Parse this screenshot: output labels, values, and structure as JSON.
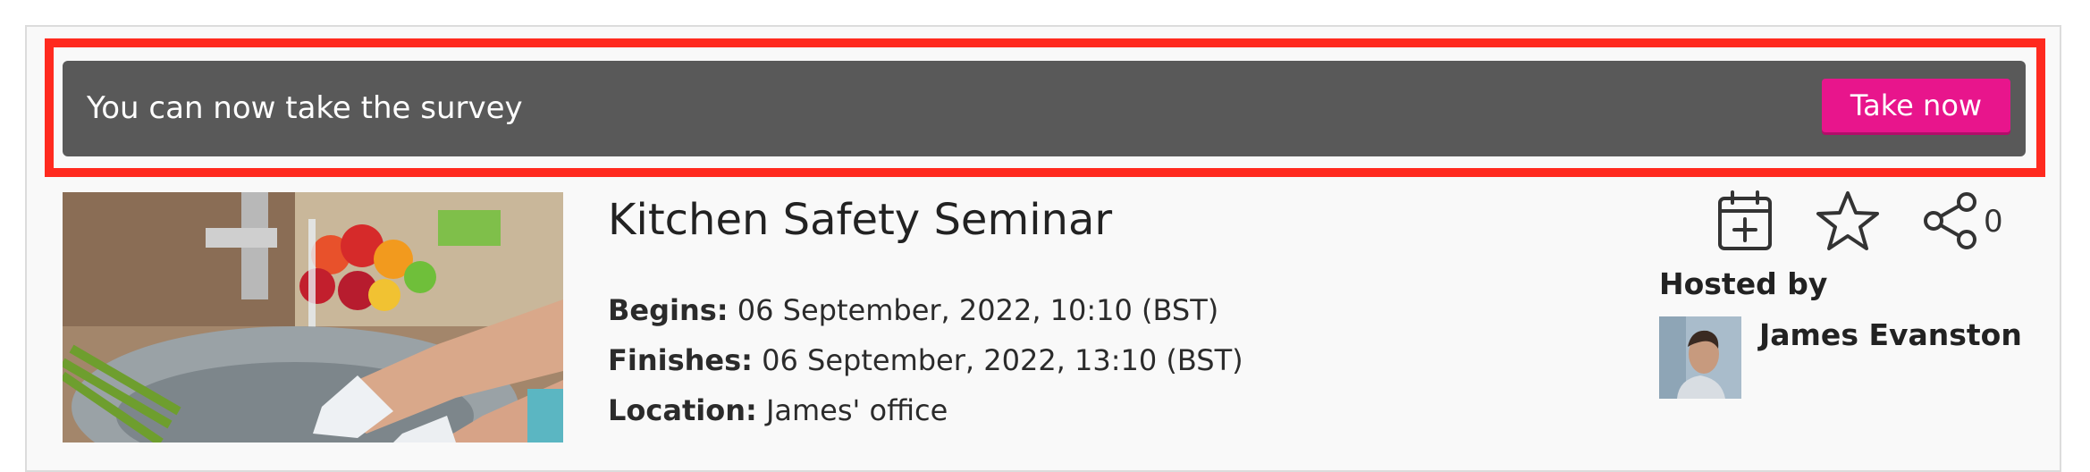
{
  "banner": {
    "message": "You can now take the survey",
    "button_label": "Take now"
  },
  "event": {
    "title": "Kitchen Safety Seminar",
    "begins_label": "Begins:",
    "begins_value": "06 September, 2022, 10:10 (BST)",
    "finishes_label": "Finishes:",
    "finishes_value": "06 September, 2022, 13:10 (BST)",
    "location_label": "Location:",
    "location_value": "James' office"
  },
  "actions": {
    "share_count": "0",
    "icons": [
      "calendar-add-icon",
      "star-icon",
      "share-icon"
    ]
  },
  "host": {
    "heading": "Hosted by",
    "name": "James Evanston"
  },
  "colors": {
    "highlight": "#ff2a1f",
    "banner_bg": "#595959",
    "accent": "#e8158c"
  }
}
